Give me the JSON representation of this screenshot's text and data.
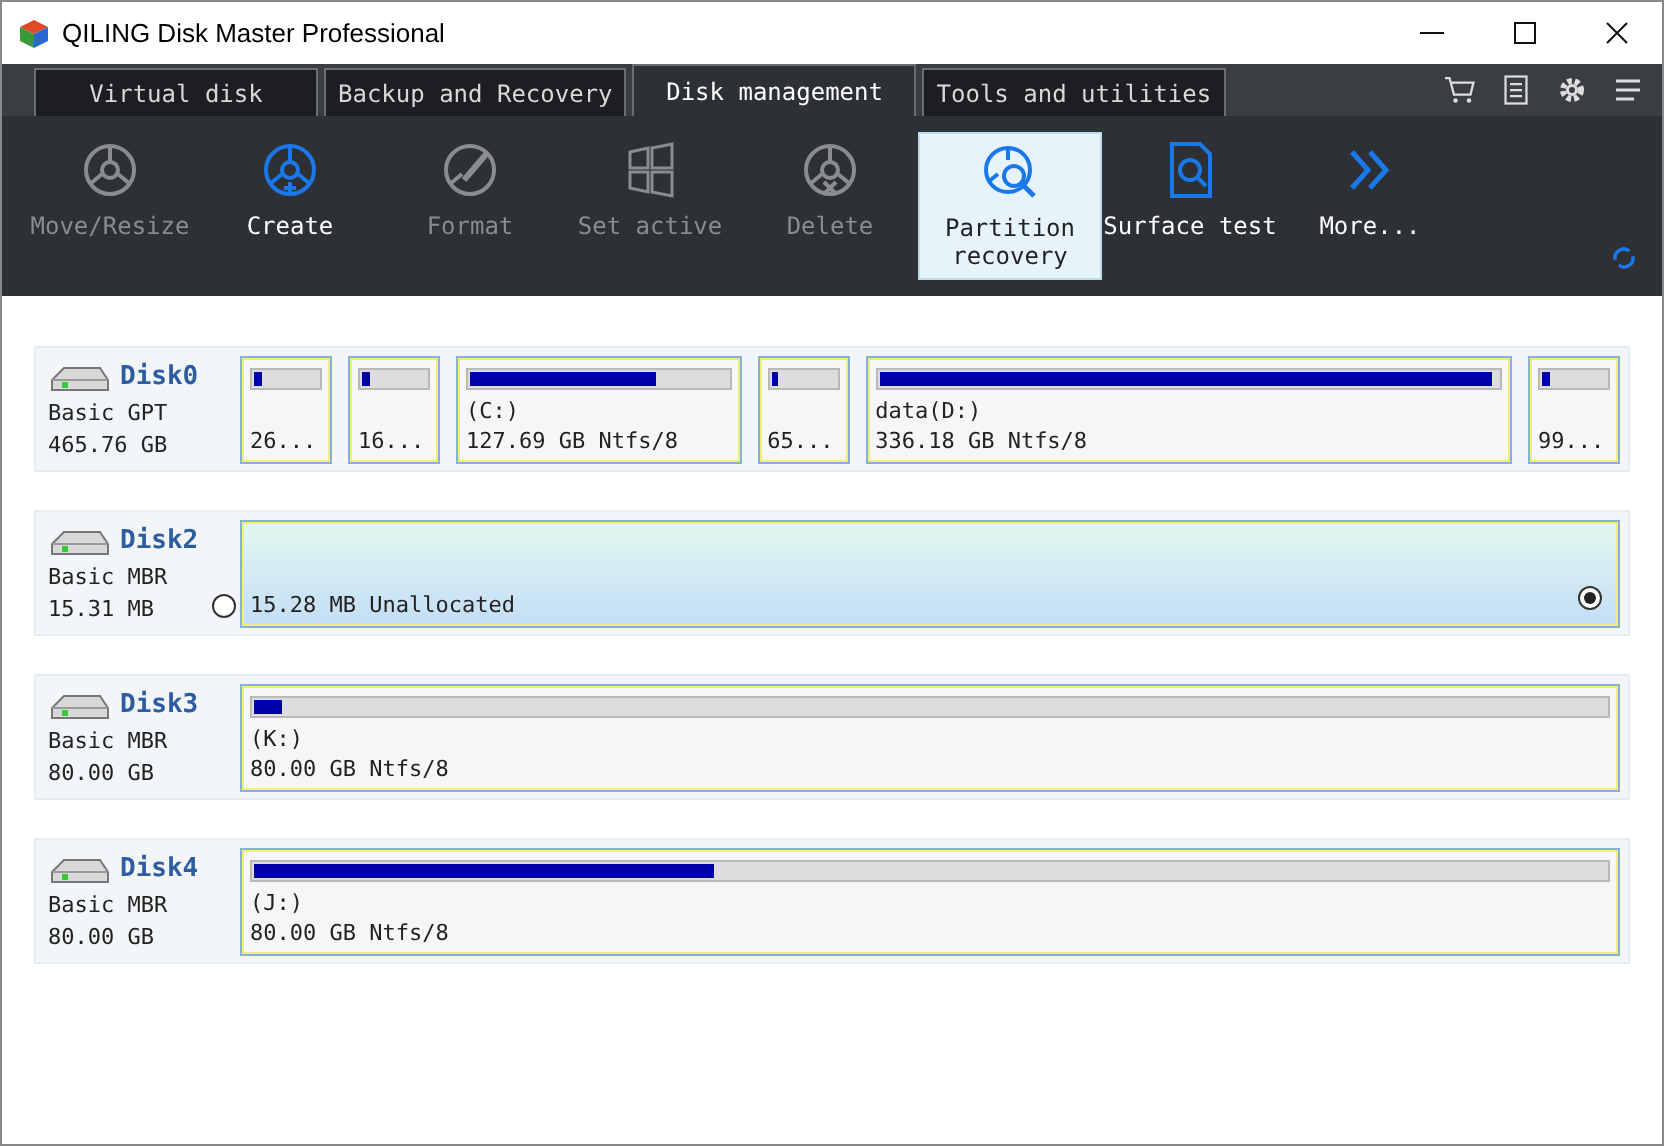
{
  "window": {
    "title": "QILING Disk Master Professional"
  },
  "tabs": [
    {
      "label": "Virtual disk",
      "selected": false
    },
    {
      "label": "Backup and Recovery",
      "selected": false
    },
    {
      "label": "Disk management",
      "selected": true
    },
    {
      "label": "Tools and utilities",
      "selected": false
    }
  ],
  "toolbar": [
    {
      "kind": "move",
      "label": "Move/Resize",
      "disabled": true,
      "selected": false
    },
    {
      "kind": "create",
      "label": "Create",
      "disabled": false,
      "selected": false
    },
    {
      "kind": "format",
      "label": "Format",
      "disabled": true,
      "selected": false
    },
    {
      "kind": "active",
      "label": "Set active",
      "disabled": true,
      "selected": false
    },
    {
      "kind": "delete",
      "label": "Delete",
      "disabled": true,
      "selected": false
    },
    {
      "kind": "recovery",
      "label": "Partition recovery",
      "disabled": false,
      "selected": true
    },
    {
      "kind": "surface",
      "label": "Surface test",
      "disabled": false,
      "selected": false
    },
    {
      "kind": "more",
      "label": "More...",
      "disabled": false,
      "selected": false
    }
  ],
  "disks": [
    {
      "name": "Disk0",
      "type": "Basic GPT",
      "size": "465.76 GB",
      "partitions": [
        {
          "kind": "small",
          "level": 0.12,
          "size": "26..."
        },
        {
          "kind": "small",
          "level": 0.12,
          "size": "16..."
        },
        {
          "kind": "normal",
          "level": 0.72,
          "label": "(C:)",
          "size": "127.69 GB Ntfs/8"
        },
        {
          "kind": "small",
          "level": 0.12,
          "size": "65..."
        },
        {
          "kind": "wide",
          "level": 0.99,
          "label": "data(D:)",
          "size": "336.18 GB Ntfs/8"
        },
        {
          "kind": "small",
          "level": 0.12,
          "size": "99..."
        }
      ]
    },
    {
      "name": "Disk2",
      "type": "Basic MBR",
      "size": "15.31 MB",
      "selected": false,
      "partitions": [
        {
          "kind": "unallocated",
          "size": "15.28 MB Unallocated",
          "selected": true
        }
      ]
    },
    {
      "name": "Disk3",
      "type": "Basic MBR",
      "size": "80.00 GB",
      "partitions": [
        {
          "kind": "wide",
          "level": 0.02,
          "label": "(K:)",
          "size": "80.00 GB Ntfs/8"
        }
      ]
    },
    {
      "name": "Disk4",
      "type": "Basic MBR",
      "size": "80.00 GB",
      "partitions": [
        {
          "kind": "wide",
          "level": 0.34,
          "label": "(J:)",
          "size": "80.00 GB Ntfs/8"
        }
      ]
    }
  ]
}
